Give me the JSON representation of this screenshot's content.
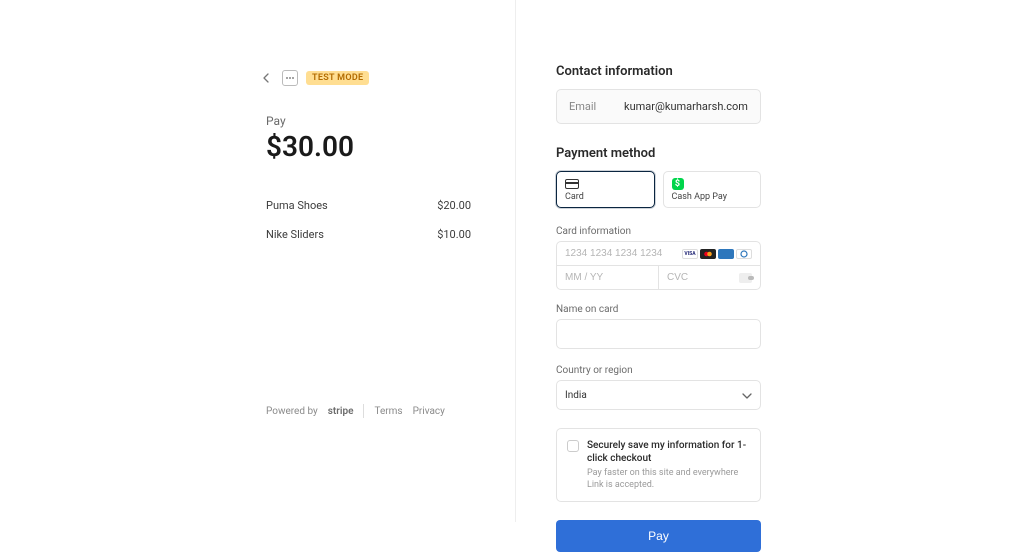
{
  "badge": "TEST MODE",
  "left": {
    "pay_label": "Pay",
    "amount": "$30.00",
    "items": [
      {
        "name": "Puma Shoes",
        "price": "$20.00"
      },
      {
        "name": "Nike Sliders",
        "price": "$10.00"
      }
    ],
    "footer": {
      "powered_by": "Powered by",
      "brand": "stripe",
      "terms": "Terms",
      "privacy": "Privacy"
    }
  },
  "contact": {
    "heading": "Contact information",
    "email_label": "Email",
    "email_value": "kumar@kumarharsh.com"
  },
  "payment": {
    "heading": "Payment method",
    "options": {
      "card": "Card",
      "cashapp": "Cash App Pay"
    },
    "card_info_label": "Card information",
    "card_number_placeholder": "1234 1234 1234 1234",
    "expiry_placeholder": "MM / YY",
    "cvc_placeholder": "CVC",
    "name_label": "Name on card",
    "country_label": "Country or region",
    "country_value": "India"
  },
  "save": {
    "title": "Securely save my information for 1-click checkout",
    "sub": "Pay faster on this site and everywhere Link is accepted."
  },
  "pay_button": "Pay"
}
